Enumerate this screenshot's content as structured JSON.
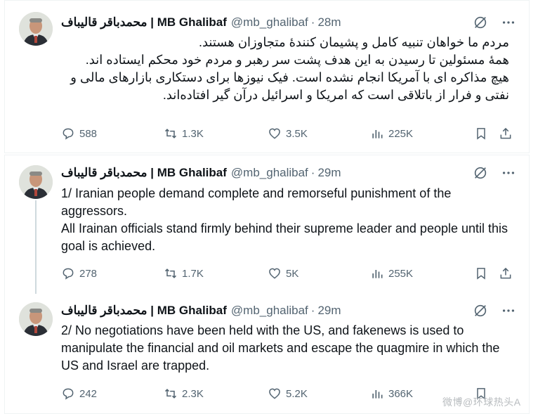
{
  "tweets": [
    {
      "name": "محمدباقر قالیباف | MB Ghalibaf",
      "handle": "@mb_ghalibaf",
      "time": "28m",
      "lines": [
        "مردم ما خواهان تنبیه کامل و پشیمان کنندهٔ متجاوزان هستند.",
        "همهٔ مسئولین تا رسیدن به این هدف پشت سر رهبر و مردم خود محکم ایستاده اند.",
        "هیچ مذاکره ای با آمریکا انجام نشده است. فیک نیوزها برای دستکاری بازارهای مالی و",
        "نفتی و فرار از باتلاقی است که امریکا و اسرائیل درآن گیر افتاده‌اند."
      ],
      "replies": "588",
      "reposts": "1.3K",
      "likes": "3.5K",
      "views": "225K"
    },
    {
      "name": "محمدباقر قالیباف | MB Ghalibaf",
      "handle": "@mb_ghalibaf",
      "time": "29m",
      "lines": [
        "1/ Iranian people demand complete and remorseful punishment of the aggressors.",
        "All Irainan officials stand firmly behind their supreme leader and people until this goal is achieved."
      ],
      "replies": "278",
      "reposts": "1.7K",
      "likes": "5K",
      "views": "255K"
    },
    {
      "name": "محمدباقر قالیباف | MB Ghalibaf",
      "handle": "@mb_ghalibaf",
      "time": "29m",
      "lines": [
        "2/ No negotiations have been held with the US, and fakenews is used to manipulate the financial and oil markets and escape the quagmire in which the US and Israel are trapped."
      ],
      "replies": "242",
      "reposts": "2.3K",
      "likes": "5.2K",
      "views": "366K"
    }
  ],
  "watermark": "微博@环球热头A",
  "colors": {
    "text": "#0f1419",
    "secondary": "#536471",
    "border": "#eff3f4",
    "thread": "#cfd9de"
  },
  "icons": [
    "grok-icon",
    "more-icon",
    "reply-icon",
    "repost-icon",
    "like-icon",
    "views-icon",
    "bookmark-icon",
    "share-icon"
  ]
}
